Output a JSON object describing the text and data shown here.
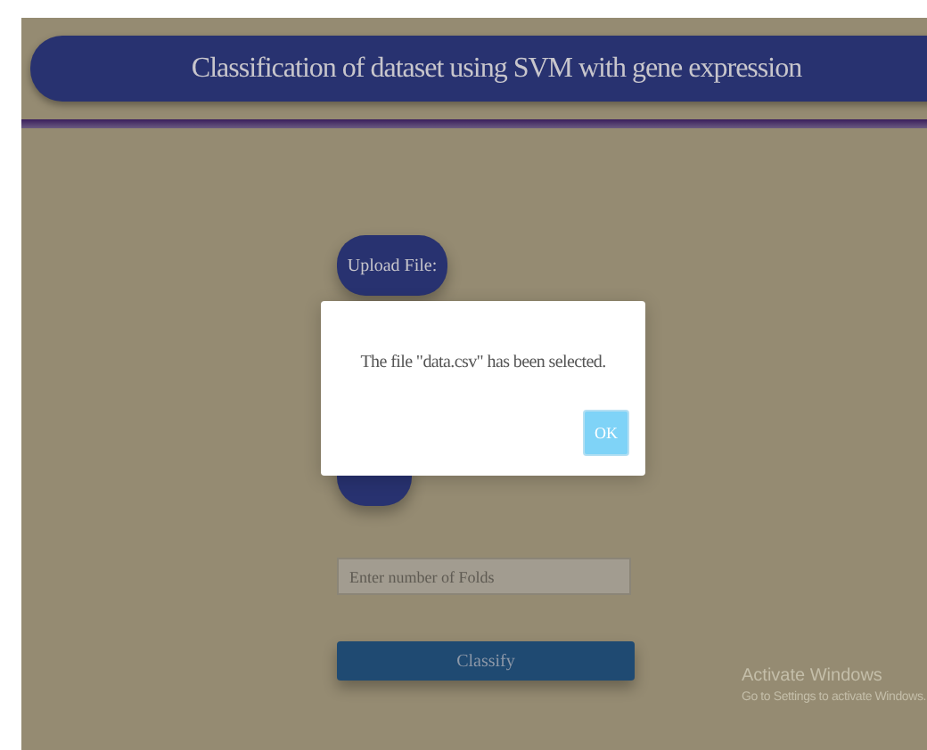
{
  "header": {
    "title": "Classification of dataset using SVM with gene expression"
  },
  "upload_button": {
    "label": "Upload File:"
  },
  "dialog": {
    "message": "The file \"data.csv\" has been selected.",
    "button": "OK"
  },
  "folds_field": {
    "placeholder": "Enter number of Folds"
  },
  "classify_button": {
    "label": "Classify"
  },
  "os_notice": {
    "title": "Activate Windows",
    "subtitle": "Go to Settings to activate Windows."
  }
}
